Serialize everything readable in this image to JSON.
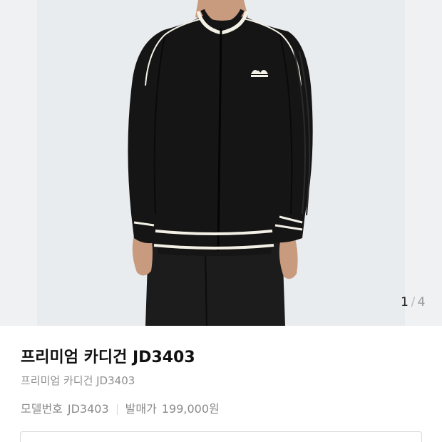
{
  "gallery": {
    "current_page": "1",
    "separator": "/",
    "total_pages": "4",
    "colors": {
      "background": "#e8ecef",
      "garment": "#151515",
      "trim": "#f3f0e6",
      "skin": "#c89a7e"
    }
  },
  "product": {
    "title": "프리미엄 카디건 JD3403",
    "subtitle": "프리미엄 카디건 JD3403",
    "model_label": "모델번호",
    "model_value": "JD3403",
    "price_label": "발매가",
    "price_value": "199,000원"
  }
}
